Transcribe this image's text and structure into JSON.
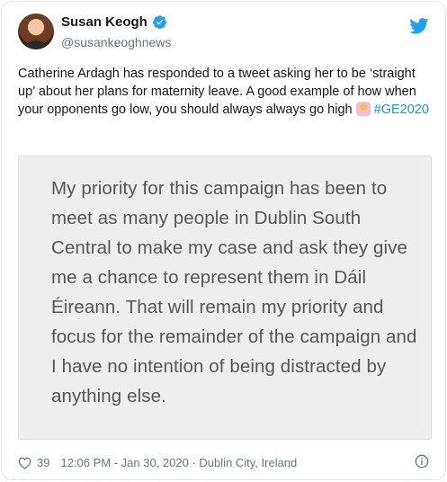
{
  "user": {
    "display_name": "Susan Keogh",
    "handle": "@susankeoghnews"
  },
  "tweet": {
    "text_main": "Catherine Ardagh has responded to a tweet asking her to be ‘straight up’ about her plans for maternity leave. A good example of how when your opponents go low, you should always always go high ",
    "hashtag": "#GE2020",
    "image_text": "My priority for this campaign has been to meet as many people in Dublin South Central to make my case and ask they give me a chance to represent them in Dáil Éireann. That will remain my priority and focus for the remainder of the campaign and I have no intention of being distracted by anything else."
  },
  "footer": {
    "likes": "39",
    "timestamp": "12:06 PM - Jan 30, 2020",
    "separator": " · ",
    "location": "Dublin City, Ireland"
  },
  "colors": {
    "twitter_blue": "#1da1f2",
    "hashtag": "#1b95e0",
    "muted": "#657786"
  },
  "icons": {
    "verified": "verified-badge-icon",
    "bird": "twitter-bird-icon",
    "heart": "heart-icon",
    "info": "info-icon",
    "emoji": "person-raising-hand-emoji"
  }
}
